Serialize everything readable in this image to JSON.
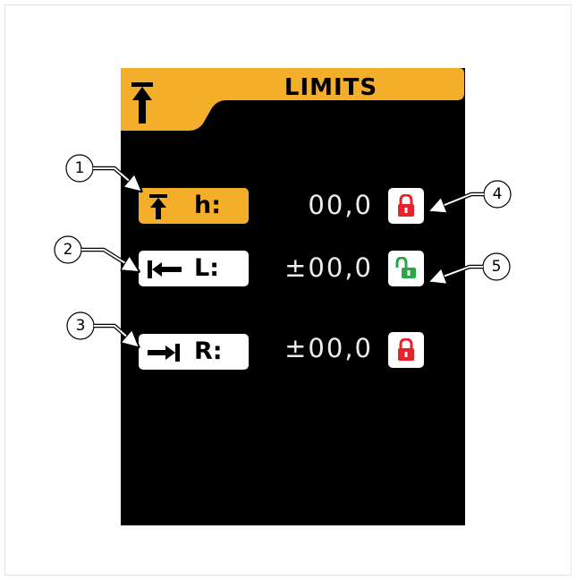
{
  "header": {
    "title": "LIMITS",
    "icon": "height-limit-icon",
    "color": "#f3ae2a"
  },
  "rows": [
    {
      "label": "h:",
      "value": "00,0",
      "icon": "height-limit-icon",
      "lock": "locked",
      "lock_color": "#e8222a",
      "active": true
    },
    {
      "label": "L:",
      "value": "±00,0",
      "icon": "left-limit-icon",
      "lock": "unlocked",
      "lock_color": "#27a845",
      "active": false
    },
    {
      "label": "R:",
      "value": "±00,0",
      "icon": "right-limit-icon",
      "lock": "locked",
      "lock_color": "#e8222a",
      "active": false
    }
  ],
  "callouts": [
    "1",
    "2",
    "3",
    "4",
    "5"
  ]
}
